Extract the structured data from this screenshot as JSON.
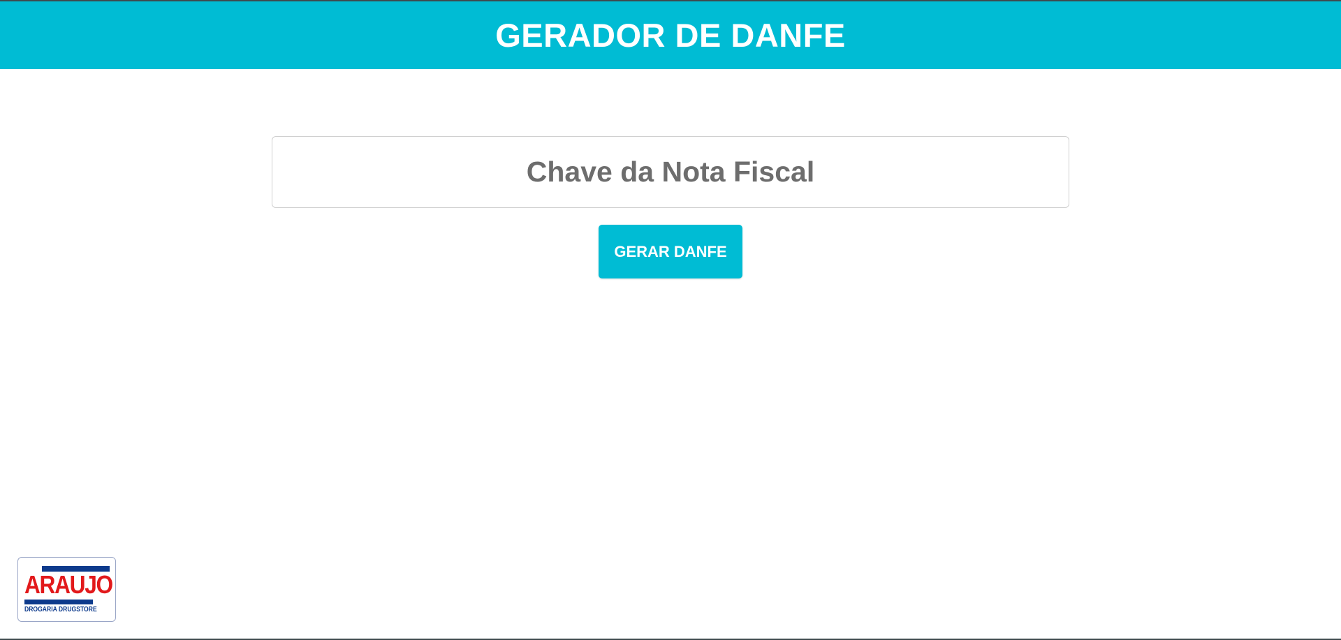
{
  "header": {
    "title": "GERADOR DE DANFE"
  },
  "form": {
    "key_input": {
      "placeholder": "Chave da Nota Fiscal",
      "value": ""
    },
    "generate_button_label": "GERAR DANFE"
  },
  "logo": {
    "brand": "ARAUJO",
    "subtitle": "DROGARIA DRUGSTORE"
  },
  "colors": {
    "accent": "#00bcd4",
    "logo_red": "#e2191b",
    "logo_blue": "#0d3a8c"
  }
}
